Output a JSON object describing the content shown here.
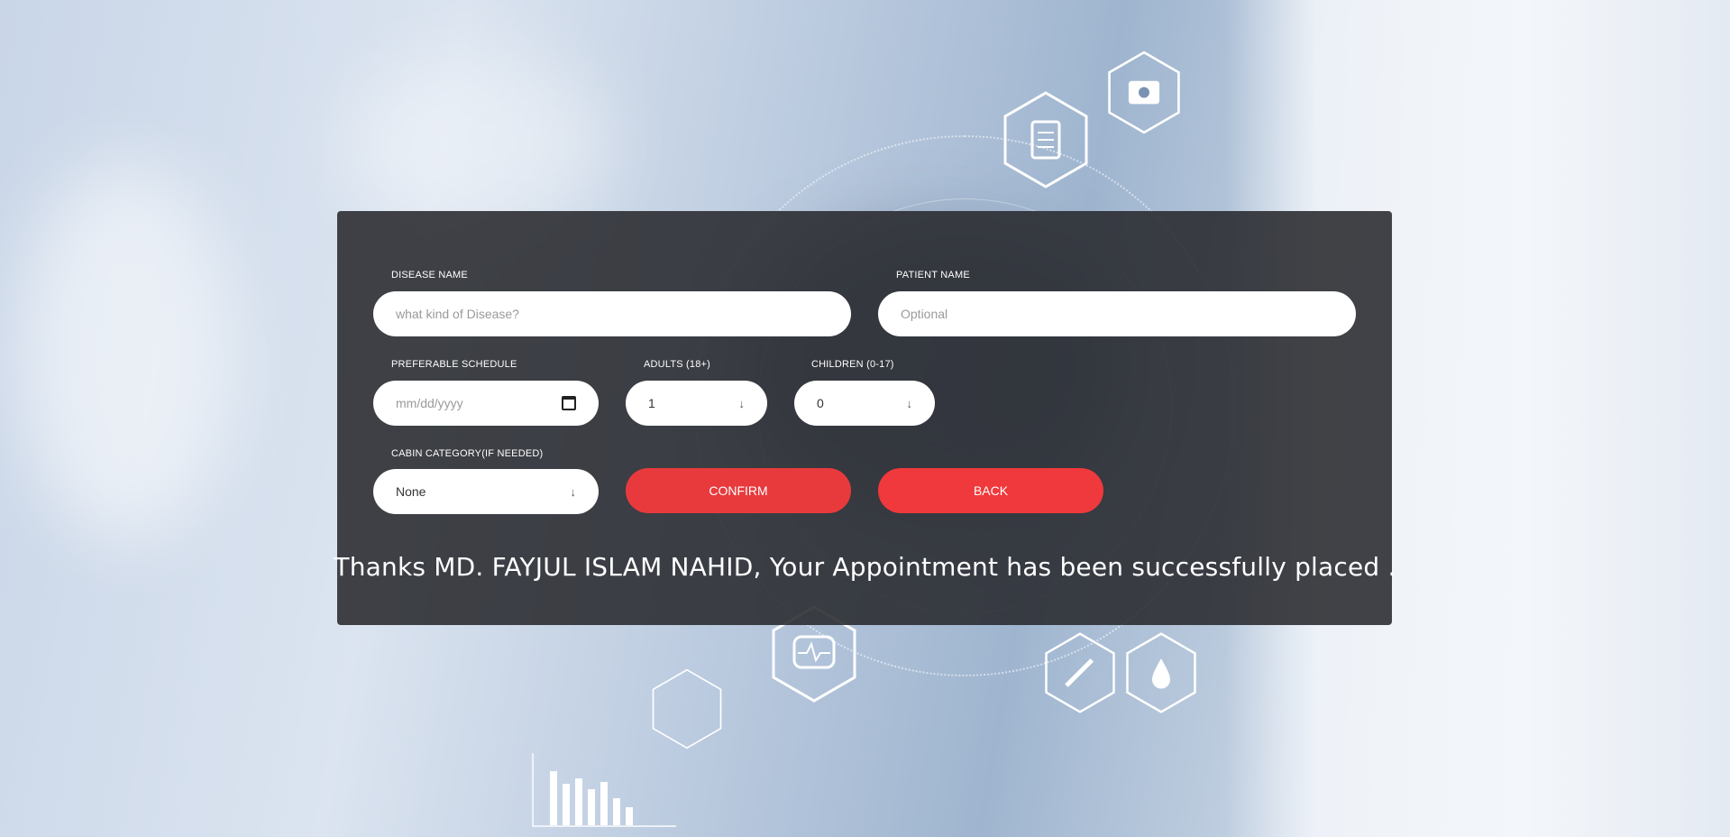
{
  "form": {
    "disease_label": "DISEASE NAME",
    "disease_placeholder": "what kind of Disease?",
    "patient_label": "PATIENT NAME",
    "patient_placeholder": "Optional",
    "schedule_label": "PREFERABLE SCHEDULE",
    "schedule_placeholder": "mm/dd/yyyy",
    "adults_label": "ADULTS (18+)",
    "adults_value": "1",
    "children_label": "CHILDREN (0-17)",
    "children_value": "0",
    "cabin_label": "CABIN CATEGORY(IF NEEDED)",
    "cabin_value": "None",
    "confirm_label": "CONFIRM",
    "back_label": "BACK"
  },
  "message": {
    "text": "Thanks MD. FAYJUL ISLAM NAHID, Your Appointment has been successfully placed ."
  },
  "icons": {
    "date": "calendar-icon",
    "select": "arrow-down-icon",
    "background": [
      "clipboard-icon",
      "medical-kit-icon",
      "monitor-icon",
      "syringe-icon",
      "drop-icon"
    ]
  },
  "colors": {
    "panel": "#28292e",
    "button": "#e83a3d",
    "text": "#ffffff"
  }
}
